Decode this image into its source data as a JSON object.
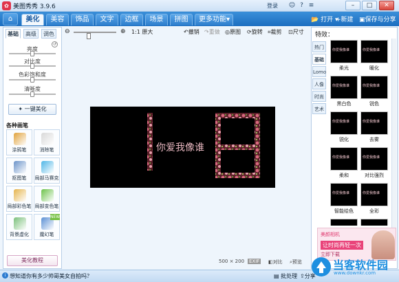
{
  "window": {
    "title": "美图秀秀 3.9.6",
    "login": "登录",
    "icon": "meitu-logo-icon"
  },
  "nav": {
    "tabs": [
      "美化",
      "美容",
      "饰品",
      "文字",
      "边框",
      "场景",
      "拼图",
      "更多功能"
    ],
    "active": "美化",
    "more_arrow": "▾",
    "open": "打开",
    "new": "新建",
    "save": "保存与分享"
  },
  "sidebar": {
    "tabs": [
      "基础",
      "高级",
      "调色"
    ],
    "sliders": [
      {
        "label": "亮度",
        "value": 0.5
      },
      {
        "label": "对比度",
        "value": 0.5
      },
      {
        "label": "色彩饱和度",
        "value": 0.5
      },
      {
        "label": "清晰度",
        "value": 0.5
      }
    ],
    "one_key": "一键美化",
    "brushes_title": "各种画笔",
    "brushes": [
      {
        "name": "涂鸦笔",
        "icon": "pencil-icon",
        "color": "#e0a23c"
      },
      {
        "name": "消除笔",
        "icon": "eraser-icon",
        "color": "#d8d8d8"
      },
      {
        "name": "抠图笔",
        "icon": "cutout-pen-icon",
        "color": "#6a93c9"
      },
      {
        "name": "局部马赛克",
        "icon": "mosaic-icon",
        "color": "#4db6e6"
      },
      {
        "name": "局部彩色笔",
        "icon": "color-brush-icon",
        "color": "#e5b44d"
      },
      {
        "name": "局部变色笔",
        "icon": "recolor-brush-icon",
        "color": "#6cc24a"
      },
      {
        "name": "背景虚化",
        "icon": "background-blur-icon",
        "color": "#7ac07b"
      },
      {
        "name": "魔幻笔",
        "icon": "magic-wand-icon",
        "color": "#5a8fd4",
        "new": "NEW"
      }
    ],
    "tutorial": "美化教程"
  },
  "toolbar": {
    "zoom_fit": "1:1",
    "zoom_label": "原大",
    "undo": "撤销",
    "redo": "重做",
    "original": "原图",
    "rotate": "旋转",
    "crop": "裁剪",
    "size": "尺寸"
  },
  "canvas": {
    "size": "500 × 200",
    "compare": "对比",
    "preview": "预览",
    "image_text": "你爱我像谁"
  },
  "effects": {
    "title": "特效：",
    "categories": [
      "热门",
      "基础",
      "Lomo",
      "人像",
      "时尚",
      "艺术"
    ],
    "active": "基础",
    "items": [
      "柔光",
      "暖化",
      "黑白色",
      "锐色",
      "锐化",
      "去雾",
      "柔和",
      "对比强烈",
      "智能绘色",
      "全彩"
    ],
    "thumb_text": "你爱我像谁"
  },
  "ad": {
    "line1": "美颜相机",
    "line2": "让时尚再轻一次",
    "line3": "立即下载"
  },
  "status": {
    "tip": "想知道你有多少帅哥美女自拍吗？",
    "batch": "批处理",
    "share": "分享"
  },
  "watermark": {
    "brand": "当客软件园",
    "url": "www.downkr.com"
  }
}
